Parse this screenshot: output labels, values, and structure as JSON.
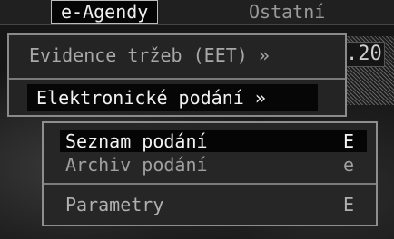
{
  "menubar": {
    "active_label": "e-Agendy",
    "other_label": "Ostatní"
  },
  "background": {
    "field_value": ".20"
  },
  "dropdown": {
    "items": [
      {
        "label": "Evidence tržeb (EET) »"
      },
      {
        "label": "Elektronické podání  »"
      }
    ]
  },
  "submenu": {
    "items": [
      {
        "label": "Seznam podání",
        "shortcut": "E"
      },
      {
        "label": "Archiv podání",
        "shortcut": "e"
      },
      {
        "label": "Parametry",
        "shortcut": "E"
      }
    ]
  }
}
